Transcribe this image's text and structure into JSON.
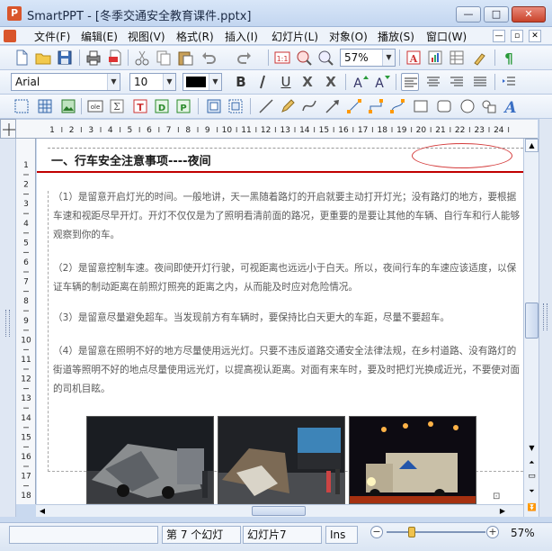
{
  "window": {
    "app_icon": "P",
    "title": "SmartPPT - [冬季交通安全教育课件.pptx]",
    "min_label": "—",
    "max_label": "□",
    "close_label": "✕"
  },
  "menu": {
    "items": [
      "文件(F)",
      "编辑(E)",
      "视图(V)",
      "格式(R)",
      "插入(I)",
      "幻灯片(L)",
      "对象(O)",
      "播放(S)",
      "窗口(W)"
    ],
    "mdi_min": "—",
    "mdi_restore": "▫",
    "mdi_close": "✕"
  },
  "toolbar": {
    "zoom_value": "57%",
    "font_name": "Arial",
    "font_size": "10",
    "font_color": "#000000"
  },
  "ruler": {
    "h_numbers": [
      "1",
      "2",
      "3",
      "4",
      "5",
      "6",
      "7",
      "8",
      "9",
      "10",
      "11",
      "12",
      "13",
      "14",
      "15",
      "16",
      "17",
      "18",
      "19",
      "20",
      "21",
      "22",
      "23",
      "24"
    ],
    "v_numbers": [
      "1",
      "2",
      "3",
      "4",
      "5",
      "6",
      "7",
      "8",
      "9",
      "10",
      "11",
      "12",
      "13",
      "14",
      "15",
      "16",
      "17",
      "18"
    ]
  },
  "slide": {
    "heading": "一、行车安全注意事项----夜间",
    "paragraphs": [
      "（1）是留意开启灯光的时间。一般地讲，天一黑随着路灯的开启就要主动打开灯光；没有路灯的地方，要根据车速和视距尽早开灯。开灯不仅仅是为了照明看清前面的路况，更重要的是要让其他的车辆、自行车和行人能够观察到你的车。",
      "（2）是留意控制车速。夜间即使开灯行驶，可视距离也远远小于白天。所以，夜间行车的车速应该适度，以保证车辆的制动距离在前照灯照亮的距离之内，从而能及时应对危险情况。",
      "（3）是留意尽量避免超车。当发现前方有车辆时，要保持比白天更大的车距，尽量不要超车。",
      "（4）是留意在照明不好的地方尽量使用远光灯。只要不违反道路交通安全法律法规，在乡村道路、没有路灯的街道等照明不好的地点尽量使用远光灯，以提高视认距离。对面有来车时，要及时把灯光换成近光，不要使对面的司机目眩。"
    ],
    "accent_color": "#c00000"
  },
  "status": {
    "slide_index": "第 7 个幻灯",
    "slide_name": "幻灯片7",
    "mode": "Ins",
    "zoom": "57%",
    "zoom_minus": "−",
    "zoom_plus": "+"
  }
}
